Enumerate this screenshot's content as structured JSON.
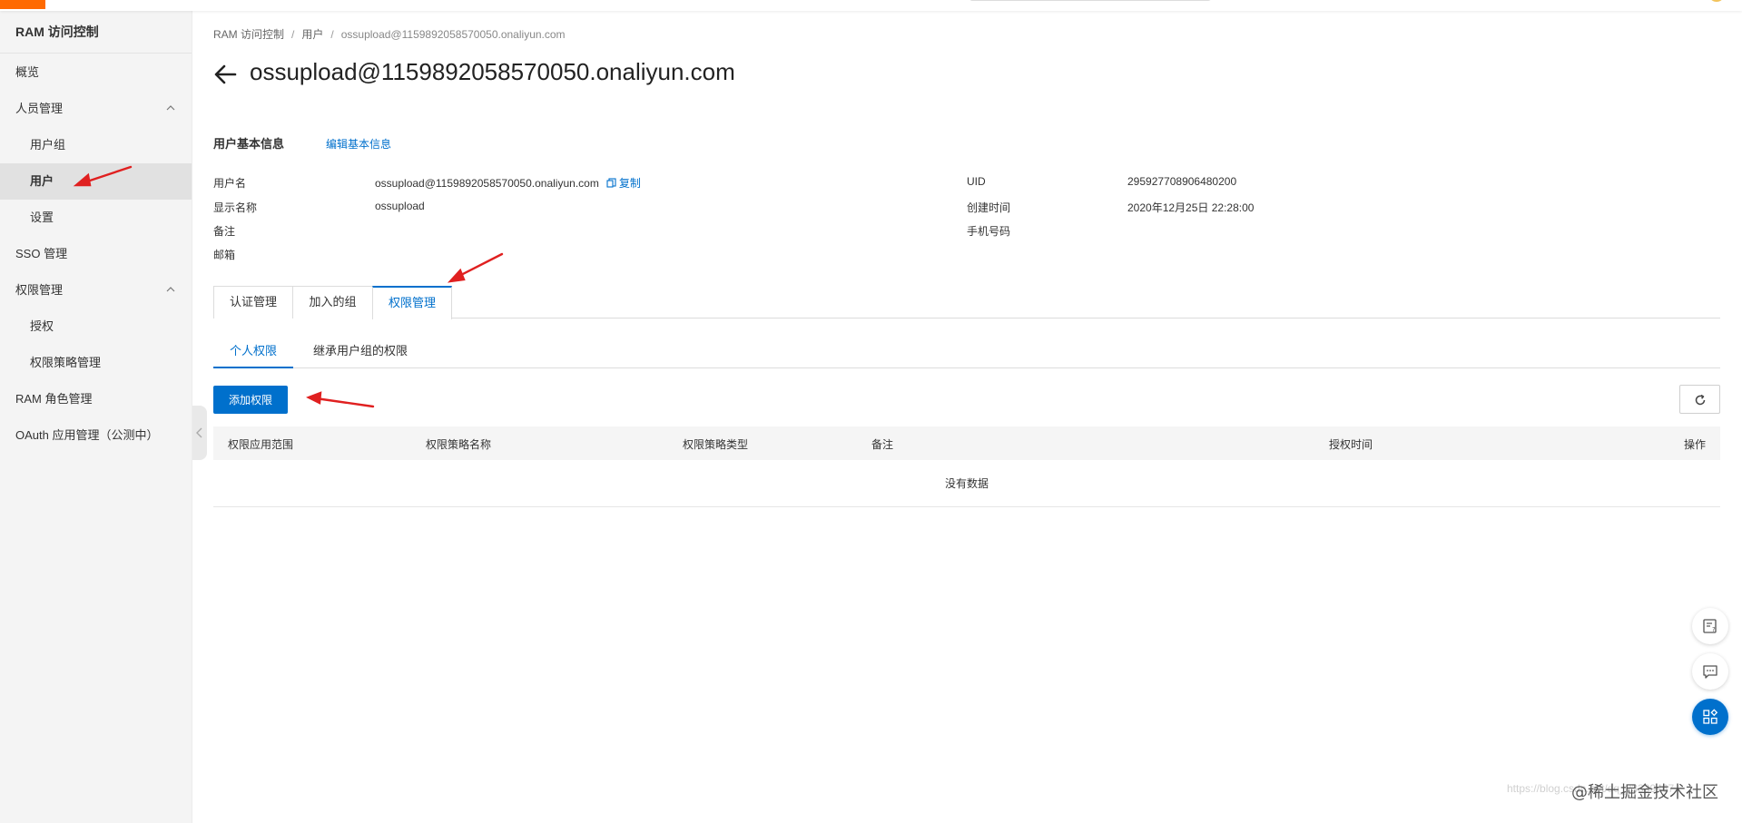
{
  "sidebar": {
    "title": "RAM 访问控制",
    "items": [
      {
        "label": "概览"
      },
      {
        "label": "人员管理"
      },
      {
        "label": "用户组"
      },
      {
        "label": "用户"
      },
      {
        "label": "设置"
      },
      {
        "label": "SSO 管理"
      },
      {
        "label": "权限管理"
      },
      {
        "label": "授权"
      },
      {
        "label": "权限策略管理"
      },
      {
        "label": "RAM 角色管理"
      },
      {
        "label": "OAuth 应用管理（公测中）"
      }
    ]
  },
  "breadcrumb": [
    "RAM 访问控制",
    "用户",
    "ossupload@1159892058570050.onaliyun.com"
  ],
  "page_title": "ossupload@1159892058570050.onaliyun.com",
  "basic_info": {
    "section_title": "用户基本信息",
    "edit_label": "编辑基本信息",
    "copy_label": "复制",
    "fields": {
      "username": {
        "label": "用户名",
        "value": "ossupload@1159892058570050.onaliyun.com"
      },
      "display_name": {
        "label": "显示名称",
        "value": "ossupload"
      },
      "remark": {
        "label": "备注",
        "value": ""
      },
      "email": {
        "label": "邮箱",
        "value": ""
      },
      "uid": {
        "label": "UID",
        "value": "295927708906480200"
      },
      "created": {
        "label": "创建时间",
        "value": "2020年12月25日 22:28:00"
      },
      "phone": {
        "label": "手机号码",
        "value": ""
      }
    }
  },
  "card_tabs": [
    {
      "label": "认证管理"
    },
    {
      "label": "加入的组"
    },
    {
      "label": "权限管理"
    }
  ],
  "line_tabs": [
    {
      "label": "个人权限"
    },
    {
      "label": "继承用户组的权限"
    }
  ],
  "add_button": "添加权限",
  "table": {
    "columns": [
      "权限应用范围",
      "权限策略名称",
      "权限策略类型",
      "备注",
      "授权时间",
      "操作"
    ],
    "empty_text": "没有数据"
  },
  "watermark": "https://blog.csdn.net/qq_23339467",
  "community": "@稀土掘金技术社区",
  "colors": {
    "accent": "#0070cc",
    "brand": "#ff6a00",
    "annotation": "#e02020"
  }
}
